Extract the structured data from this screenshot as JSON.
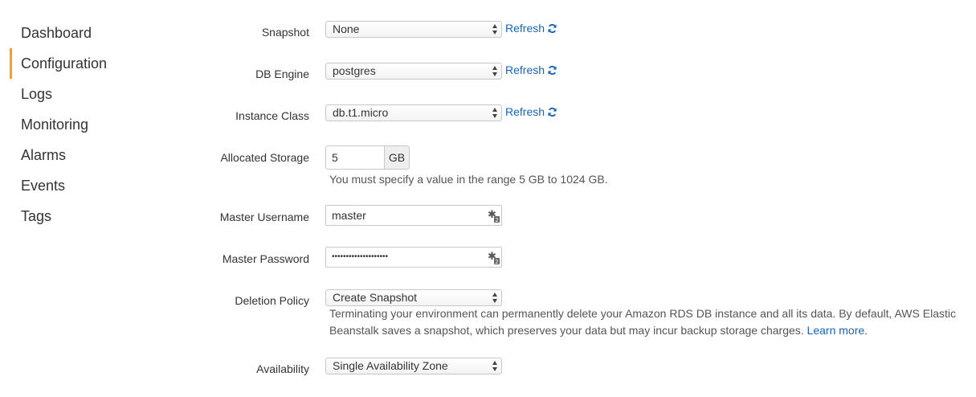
{
  "sidebar": {
    "items": [
      {
        "label": "Dashboard"
      },
      {
        "label": "Configuration"
      },
      {
        "label": "Logs"
      },
      {
        "label": "Monitoring"
      },
      {
        "label": "Alarms"
      },
      {
        "label": "Events"
      },
      {
        "label": "Tags"
      }
    ],
    "active_index": 1,
    "active_color": "#f0a030"
  },
  "form": {
    "snapshot": {
      "label": "Snapshot",
      "value": "None",
      "refresh": "Refresh"
    },
    "db_engine": {
      "label": "DB Engine",
      "value": "postgres",
      "refresh": "Refresh"
    },
    "instance_class": {
      "label": "Instance Class",
      "value": "db.t1.micro",
      "refresh": "Refresh"
    },
    "allocated_storage": {
      "label": "Allocated Storage",
      "value": "5",
      "unit": "GB",
      "help": "You must specify a value in the range 5 GB to 1024 GB."
    },
    "master_username": {
      "label": "Master Username",
      "value": "master",
      "icon": "key-icon"
    },
    "master_password": {
      "label": "Master Password",
      "value": "••••••••••••••••••••",
      "icon": "key-icon"
    },
    "deletion_policy": {
      "label": "Deletion Policy",
      "value": "Create Snapshot",
      "help_line1": "Terminating your environment can permanently delete your Amazon RDS DB instance and all its data. By default, AWS Elastic",
      "help_line2": "Beanstalk saves a snapshot, which preserves your data but may incur backup storage charges.",
      "learn_more": "Learn more."
    },
    "availability": {
      "label": "Availability",
      "value": "Single Availability Zone"
    }
  },
  "colors": {
    "link": "#1a64b6",
    "text": "#333333"
  }
}
